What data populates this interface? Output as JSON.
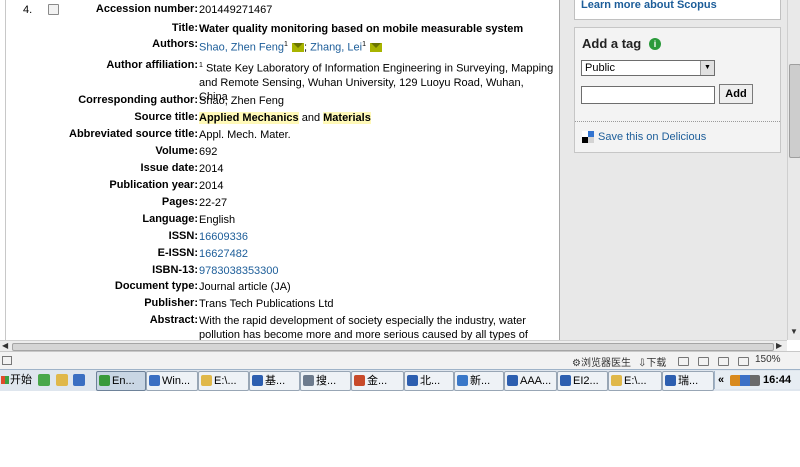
{
  "record": {
    "number": "4.",
    "fields": [
      {
        "label": "Accession number:",
        "value": "201449271467"
      },
      {
        "label": "Title:",
        "value": "Water quality monitoring based on mobile measurable system"
      },
      {
        "label": "Authors:",
        "authors": [
          {
            "name": "Shao, Zhen Feng",
            "sup": "1"
          },
          {
            "name": "Zhang, Lei",
            "sup": "1"
          }
        ],
        "separator": ";"
      },
      {
        "label": "Author affiliation:",
        "sup": "1",
        "value": "State Key Laboratory of Information Engineering in Surveying, Mapping and Remote Sensing, Wuhan University, 129 Luoyu Road, Wuhan, China"
      },
      {
        "label": "Corresponding author:",
        "value": "Shao, Zhen Feng"
      },
      {
        "label": "Source title:",
        "parts": [
          "Applied",
          " ",
          "Mechanics",
          " and ",
          "Materials"
        ]
      },
      {
        "label": "Abbreviated source title:",
        "value": "Appl. Mech. Mater."
      },
      {
        "label": "Volume:",
        "value": "692"
      },
      {
        "label": "Issue date:",
        "value": "2014"
      },
      {
        "label": "Publication year:",
        "value": "2014"
      },
      {
        "label": "Pages:",
        "value": "22-27"
      },
      {
        "label": "Language:",
        "value": "English"
      },
      {
        "label": "ISSN:",
        "value": "16609336"
      },
      {
        "label": "E-ISSN:",
        "value": "16627482"
      },
      {
        "label": "ISBN-13:",
        "value": "9783038353300"
      },
      {
        "label": "Document type:",
        "value": "Journal article (JA)"
      },
      {
        "label": "Publisher:",
        "value": "Trans Tech Publications Ltd"
      },
      {
        "label": "Abstract:",
        "value": "With the rapid development of society especially the industry, water pollution has become more and more serious caused by all types of"
      }
    ]
  },
  "sidebar": {
    "scopus_link": "Learn more about Scopus",
    "tag_title": "Add a tag",
    "info_icon": "i",
    "select_value": "Public",
    "add_button": "Add",
    "delicious_link": "Save this on Delicious"
  },
  "status_bar": {
    "guardian": "浏览器医生",
    "download": "下载",
    "zoom": "150%"
  },
  "taskbar": {
    "start": "开始",
    "buttons": [
      {
        "label": "En...",
        "icon_color": "#3a9a3a",
        "active": true
      },
      {
        "label": "Win...",
        "icon_color": "#3b6fc2",
        "active": false
      },
      {
        "label": "E:\\...",
        "icon_color": "#e0b84a",
        "active": false
      },
      {
        "label": "基...",
        "icon_color": "#2d5fb0",
        "active": false
      },
      {
        "label": "搜...",
        "icon_color": "#6d7b8d",
        "active": false
      },
      {
        "label": "金...",
        "icon_color": "#c84a2a",
        "active": false
      },
      {
        "label": "北...",
        "icon_color": "#2d5fb0",
        "active": false
      },
      {
        "label": "新...",
        "icon_color": "#3a78c8",
        "active": false
      },
      {
        "label": "AAA...",
        "icon_color": "#2d5fb0",
        "active": false
      },
      {
        "label": "EI2...",
        "icon_color": "#2d5fb0",
        "active": false
      },
      {
        "label": "E:\\...",
        "icon_color": "#e0b84a",
        "active": false
      },
      {
        "label": "瑞...",
        "icon_color": "#2d5fb0",
        "active": false
      }
    ],
    "tray_chevron": "«",
    "clock": "16:44"
  }
}
